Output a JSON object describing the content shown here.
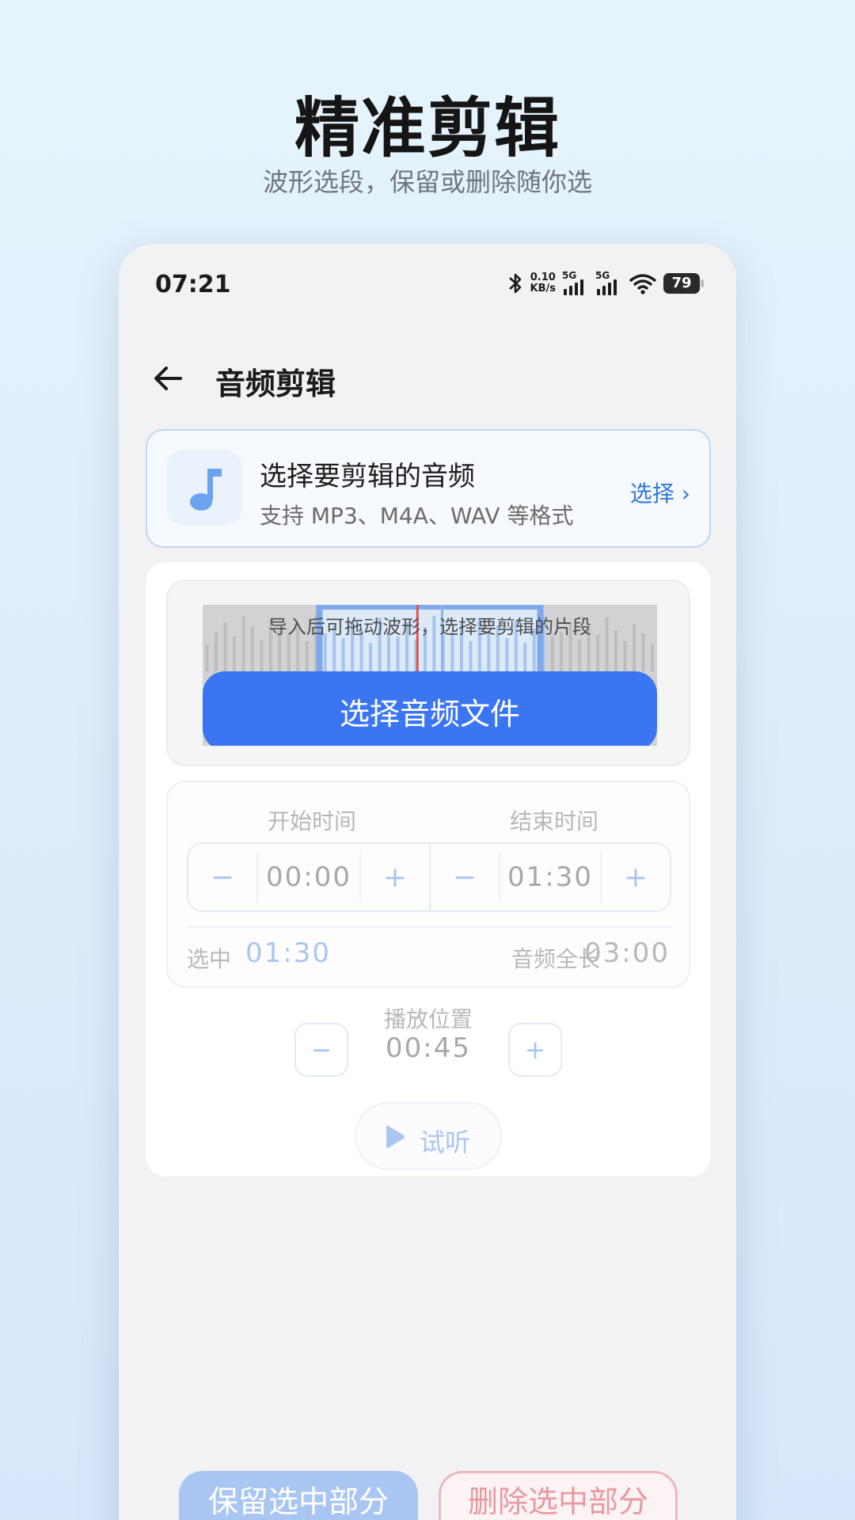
{
  "hero": {
    "title": "精准剪辑",
    "subtitle": "波形选段，保留或删除随你选"
  },
  "status_bar": {
    "time": "07:21",
    "net_speed_value": "0.10",
    "net_speed_unit": "KB/s",
    "signal_1_label": "5G",
    "signal_2_label": "5G",
    "battery": "79"
  },
  "app_bar": {
    "title": "音频剪辑"
  },
  "file_card": {
    "title": "选择要剪辑的音频",
    "subtitle": "支持 MP3、M4A、WAV 等格式",
    "action": "选择 ›"
  },
  "waveform": {
    "hint": "导入后可拖动波形，选择要剪辑的片段",
    "button": "选择音频文件",
    "selection_start_fraction": 0.25,
    "selection_end_fraction": 0.75,
    "playhead_fraction": 0.47
  },
  "time_range": {
    "start_label": "开始时间",
    "start_value": "00:00",
    "end_label": "结束时间",
    "end_value": "01:30",
    "minus": "−",
    "plus": "+",
    "selected_label": "选中",
    "selected_value": "01:30",
    "total_label": "音频全长",
    "total_value": "03:00"
  },
  "playback": {
    "label": "播放位置",
    "value": "00:45",
    "minus": "−",
    "plus": "+",
    "listen": "试听"
  },
  "actions": {
    "keep": "保留选中部分",
    "delete": "删除选中部分"
  },
  "colors": {
    "primary": "#3b76f2",
    "link": "#2f78d8",
    "disabled_blue": "#a9c6ef",
    "delete_red": "#e79aa0",
    "playhead": "#e0524f"
  }
}
